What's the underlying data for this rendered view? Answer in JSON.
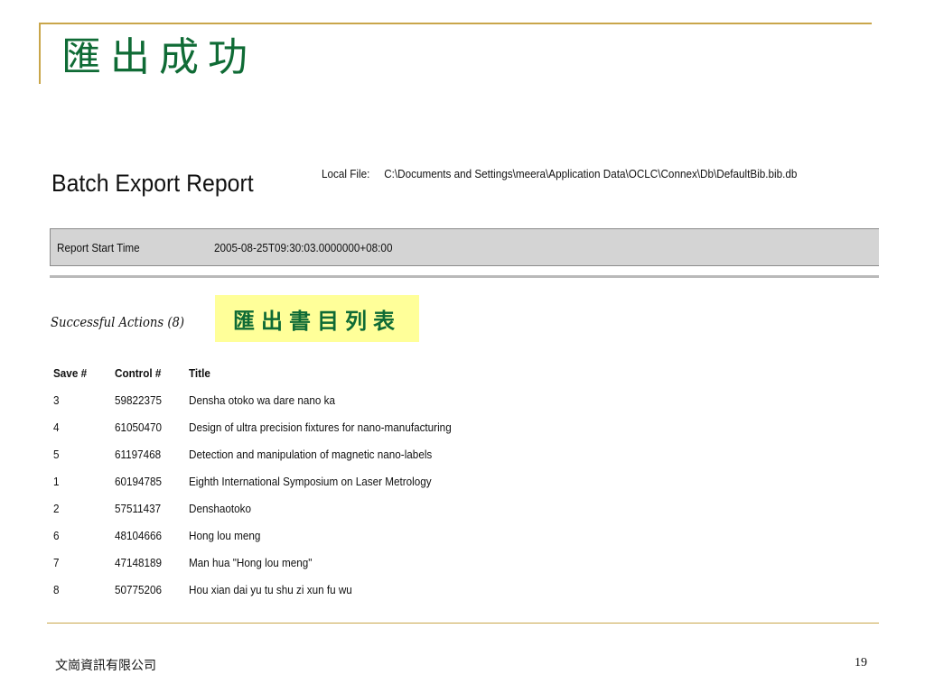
{
  "slide": {
    "title": "匯出成功",
    "footer_company": "文崗資訊有限公司",
    "page_number": "19",
    "accent_color": "#c9a64a",
    "title_color": "#0f6b35"
  },
  "report": {
    "heading": "Batch Export Report",
    "local_file_label": "Local File:",
    "local_file_path": "C:\\Documents and Settings\\meera\\Application Data\\OCLC\\Connex\\Db\\DefaultBib.bib.db",
    "start_time_label": "Report Start Time",
    "start_time_value": "2005-08-25T09:30:03.0000000+08:00",
    "successful_label": "Successful Actions (8)",
    "highlight_label": "匯出書目列表",
    "highlight_color": "#ffff99"
  },
  "table": {
    "headers": [
      "Save #",
      "Control #",
      "Title"
    ],
    "rows": [
      {
        "save": "3",
        "control": "59822375",
        "title": "Densha otoko wa dare nano ka"
      },
      {
        "save": "4",
        "control": "61050470",
        "title": "Design of ultra precision fixtures for nano-manufacturing"
      },
      {
        "save": "5",
        "control": "61197468",
        "title": "Detection and manipulation of magnetic nano-labels"
      },
      {
        "save": "1",
        "control": "60194785",
        "title": "Eighth International Symposium on Laser Metrology"
      },
      {
        "save": "2",
        "control": "57511437",
        "title": "Denshaotoko"
      },
      {
        "save": "6",
        "control": "48104666",
        "title": "Hong lou meng"
      },
      {
        "save": "7",
        "control": "47148189",
        "title": "Man hua \"Hong lou meng\""
      },
      {
        "save": "8",
        "control": "50775206",
        "title": "Hou xian dai yu tu shu zi xun fu wu"
      }
    ]
  }
}
